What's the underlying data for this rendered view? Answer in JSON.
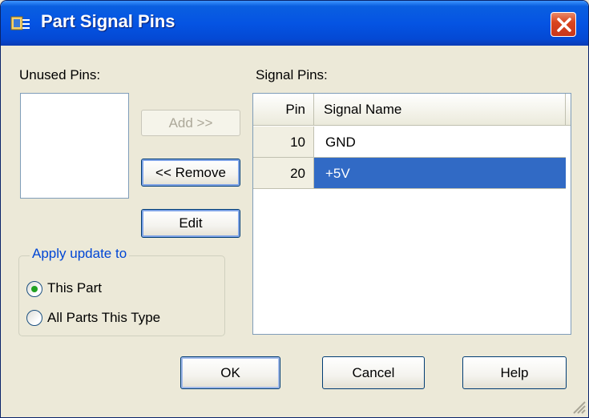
{
  "window": {
    "title": "Part Signal Pins",
    "title_icon": "part-pins-icon",
    "close_icon": "close-icon"
  },
  "unused_pins": {
    "label": "Unused Pins:",
    "items": []
  },
  "buttons": {
    "add": "Add >>",
    "remove": "<< Remove",
    "edit": "Edit",
    "ok": "OK",
    "cancel": "Cancel",
    "help": "Help"
  },
  "apply_update": {
    "title": "Apply update to",
    "options": [
      {
        "label": "This Part",
        "selected": true
      },
      {
        "label": "All Parts This Type",
        "selected": false
      }
    ]
  },
  "signal_pins": {
    "label": "Signal Pins:",
    "columns": [
      "Pin",
      "Signal Name"
    ],
    "rows": [
      {
        "pin": "10",
        "signal": "GND",
        "selected": false
      },
      {
        "pin": "20",
        "signal": "+5V",
        "selected": true
      }
    ]
  },
  "colors": {
    "title_bar": "#0554e3",
    "selection": "#316ac5",
    "group_title": "#0046d5",
    "background": "#ece9d8"
  }
}
